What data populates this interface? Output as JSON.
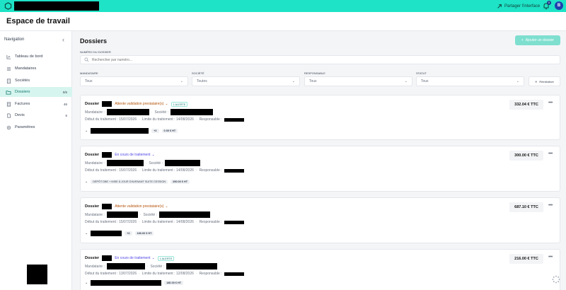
{
  "topbar": {
    "share_label": "Partager l'interface",
    "notif_count": "0",
    "avatar_letter": "B"
  },
  "workspace": {
    "title": "Espace de travail"
  },
  "sidebar": {
    "title": "Navigation",
    "items": [
      {
        "label": "Tableau de bord",
        "count": "",
        "icon": "chart-icon"
      },
      {
        "label": "Mandataires",
        "count": "",
        "icon": "list-icon"
      },
      {
        "label": "Sociétés",
        "count": "",
        "icon": "building-icon"
      },
      {
        "label": "Dossiers",
        "count": "0/6",
        "icon": "folder-icon"
      },
      {
        "label": "Factures",
        "count": "46",
        "icon": "invoice-icon"
      },
      {
        "label": "Devis",
        "count": "6",
        "icon": "quote-icon"
      },
      {
        "label": "Paramètres",
        "count": "",
        "icon": "gear-icon"
      }
    ]
  },
  "main": {
    "title": "Dossiers",
    "add_button": "Ajouter un dossier",
    "search_label": "NUMÉRO DU DOSSIER",
    "search_placeholder": "Rechercher par numéro...",
    "filters": [
      {
        "label": "MANDATAIRE",
        "value": "Tous"
      },
      {
        "label": "SOCIÉTÉ",
        "value": "Toutes"
      },
      {
        "label": "RESPONSABLE",
        "value": "Tous"
      },
      {
        "label": "STATUT",
        "value": "Tous"
      }
    ],
    "reset_label": "Réinitialiser"
  },
  "cards": [
    {
      "dossier_label": "Dossier",
      "status": "Attente validation prestataire(s)",
      "status_type": "pending",
      "alert": "1 ALERTE",
      "mandataire_label": "Mandataire :",
      "societe_label": "Société :",
      "debut": "Début du traitement : 15/07/2026",
      "limite": "Limite du traitement : 14/08/2026",
      "responsable_label": "Responsable :",
      "extra_count": "+2",
      "item_price": "0.00 € HT",
      "item_text": "",
      "price": "332.04 € TTC"
    },
    {
      "dossier_label": "Dossier",
      "status": "En cours de traitement",
      "status_type": "progress",
      "alert": "",
      "mandataire_label": "Mandataire :",
      "societe_label": "Société :",
      "debut": "Début du traitement : 15/07/2026",
      "limite": "Limite du traitement : 14/08/2026",
      "responsable_label": "Responsable :",
      "extra_count": "",
      "item_price": "250.00 € HT",
      "item_text": "DÉPÔT DBE + MISE À JOUR D'AVENANT SUITE CESSION",
      "price": "300.00 € TTC"
    },
    {
      "dossier_label": "Dossier",
      "status": "Attente validation prestataire(s)",
      "status_type": "pending",
      "alert": "",
      "mandataire_label": "Mandataire :",
      "societe_label": "Société :",
      "debut": "Début du traitement : 15/07/2026",
      "limite": "Limite du traitement : 14/08/2026",
      "responsable_label": "Responsable :",
      "extra_count": "+2",
      "item_price": "180.00 € HT",
      "item_text": "",
      "price": "687.10 € TTC"
    },
    {
      "dossier_label": "Dossier",
      "status": "En cours de traitement",
      "status_type": "progress",
      "alert": "1 ALERTE",
      "mandataire_label": "Mandataire :",
      "societe_label": "Société :",
      "debut": "Début du traitement : 13/07/2026",
      "limite": "Limite du traitement : 12/08/2026",
      "responsable_label": "Responsable :",
      "extra_count": "",
      "item_price": "180.00 € HT",
      "item_text": "",
      "price": "216.00 € TTC"
    }
  ]
}
